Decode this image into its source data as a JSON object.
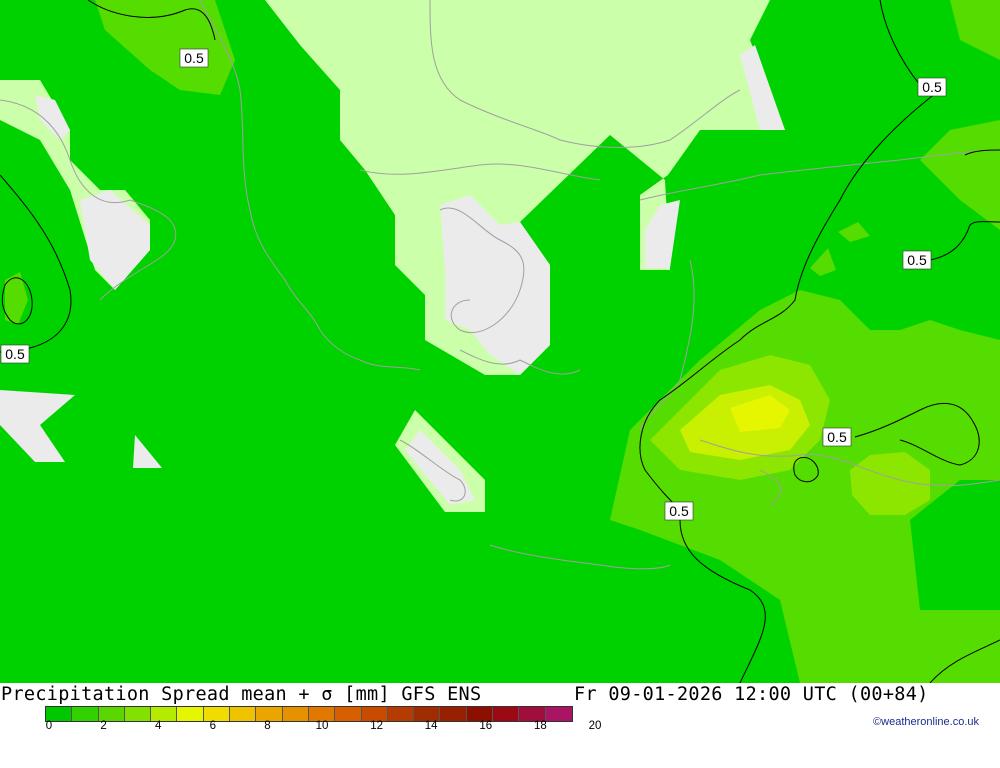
{
  "map": {
    "contour_level_label": "0.5",
    "colors": {
      "land_light": "#ccffaa",
      "no_data": "#ebebeb",
      "spread_0_2": "#00d200",
      "spread_2_4": "#55dc00",
      "spread_4_6": "#8ce600",
      "spread_6_8": "#c8f000",
      "coastline": "#a0a0a0",
      "contour": "#000000"
    }
  },
  "footer": {
    "title": "Precipitation Spread mean + σ [mm] GFS ENS",
    "valid_time": "Fr 09-01-2026 12:00 UTC (00+84)",
    "credit": "©weatheronline.co.uk",
    "legend": {
      "colors": [
        "#00c800",
        "#32d200",
        "#5ad700",
        "#82e100",
        "#b4eb00",
        "#e6f500",
        "#f0dc00",
        "#f0c300",
        "#eba500",
        "#e69100",
        "#e17800",
        "#d75f00",
        "#c84b00",
        "#b43c00",
        "#a02d00",
        "#962000",
        "#8c0f00",
        "#9b0a14",
        "#a00f3c",
        "#aa1464"
      ],
      "ticks": [
        "0",
        "2",
        "4",
        "6",
        "8",
        "10",
        "12",
        "14",
        "16",
        "18",
        "20"
      ]
    }
  }
}
